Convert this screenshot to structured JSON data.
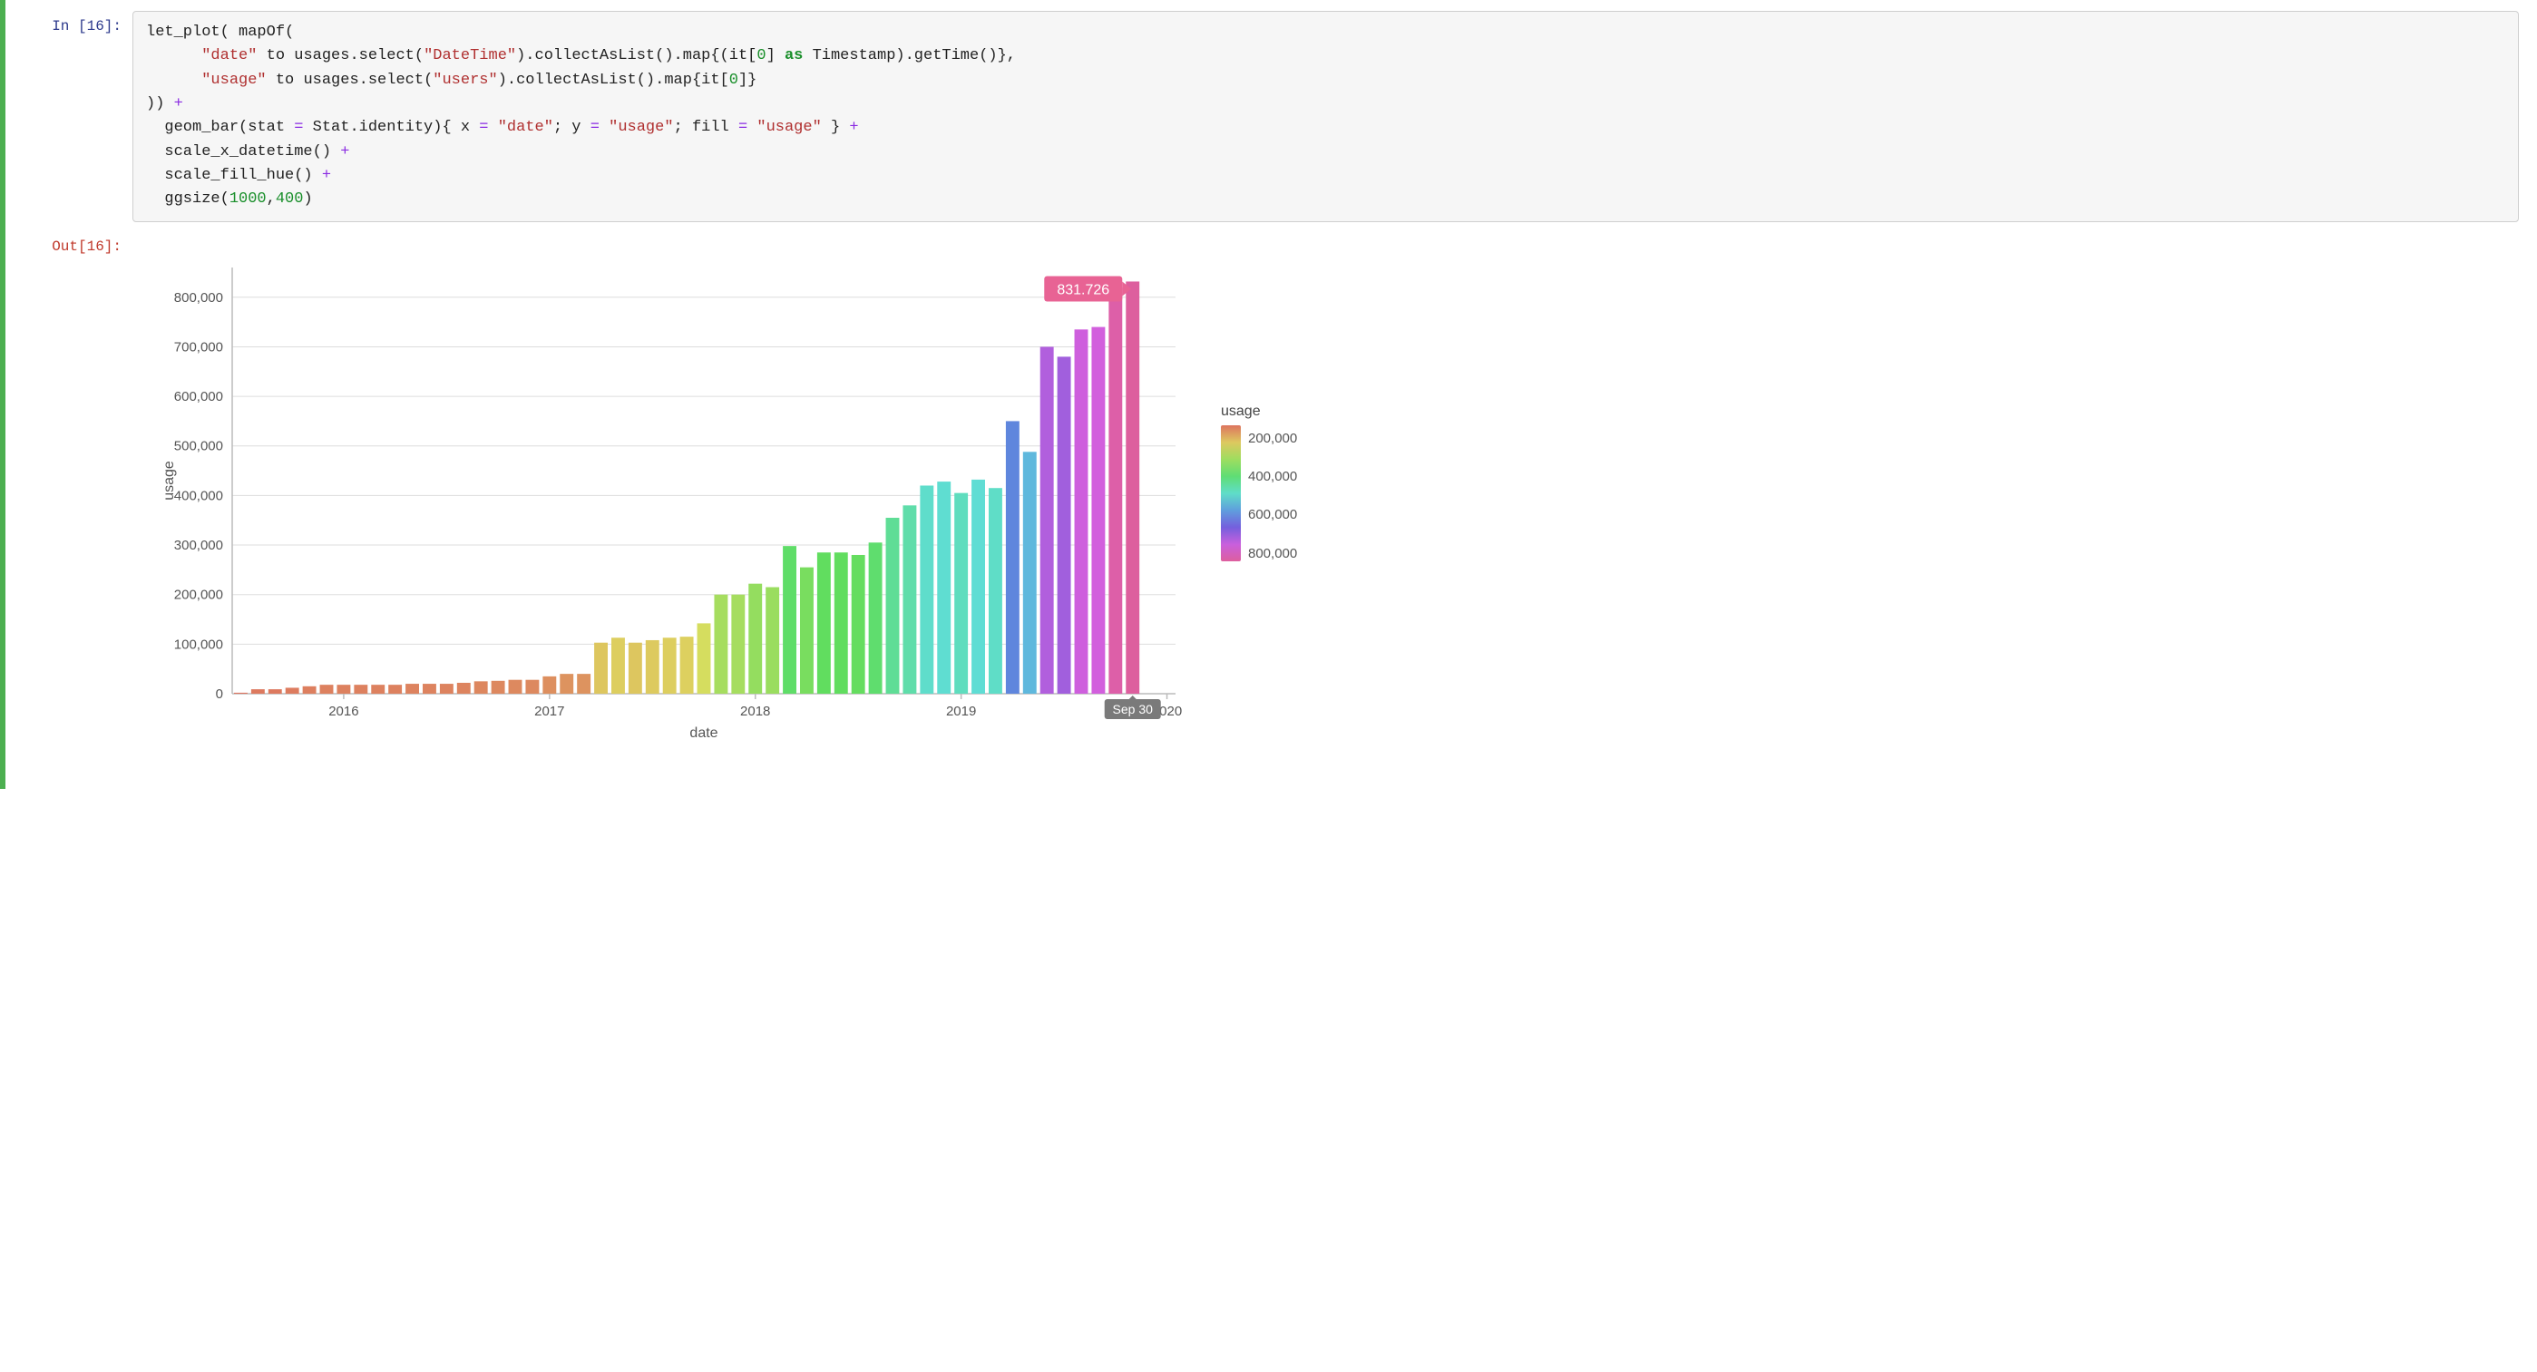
{
  "cell": {
    "in_prompt": "In [16]:",
    "out_prompt": "Out[16]:",
    "code_lines": [
      {
        "segments": [
          {
            "t": "let_plot( mapOf("
          }
        ]
      },
      {
        "segments": [
          {
            "t": "      "
          },
          {
            "t": "\"date\"",
            "c": "tok-str"
          },
          {
            "t": " to usages.select("
          },
          {
            "t": "\"DateTime\"",
            "c": "tok-str"
          },
          {
            "t": ").collectAsList().map{(it["
          },
          {
            "t": "0",
            "c": "tok-num"
          },
          {
            "t": "] "
          },
          {
            "t": "as",
            "c": "tok-kw"
          },
          {
            "t": " Timestamp).getTime()},"
          }
        ]
      },
      {
        "segments": [
          {
            "t": "      "
          },
          {
            "t": "\"usage\"",
            "c": "tok-str"
          },
          {
            "t": " to usages.select("
          },
          {
            "t": "\"users\"",
            "c": "tok-str"
          },
          {
            "t": ").collectAsList().map{it["
          },
          {
            "t": "0",
            "c": "tok-num"
          },
          {
            "t": "]}"
          }
        ]
      },
      {
        "segments": [
          {
            "t": ")) "
          },
          {
            "t": "+",
            "c": "tok-op"
          }
        ]
      },
      {
        "segments": [
          {
            "t": "  geom_bar(stat "
          },
          {
            "t": "=",
            "c": "tok-op"
          },
          {
            "t": " Stat.identity){ x "
          },
          {
            "t": "=",
            "c": "tok-op"
          },
          {
            "t": " "
          },
          {
            "t": "\"date\"",
            "c": "tok-str"
          },
          {
            "t": "; y "
          },
          {
            "t": "=",
            "c": "tok-op"
          },
          {
            "t": " "
          },
          {
            "t": "\"usage\"",
            "c": "tok-str"
          },
          {
            "t": "; fill "
          },
          {
            "t": "=",
            "c": "tok-op"
          },
          {
            "t": " "
          },
          {
            "t": "\"usage\"",
            "c": "tok-str"
          },
          {
            "t": " } "
          },
          {
            "t": "+",
            "c": "tok-op"
          }
        ]
      },
      {
        "segments": [
          {
            "t": "  scale_x_datetime() "
          },
          {
            "t": "+",
            "c": "tok-op"
          }
        ]
      },
      {
        "segments": [
          {
            "t": "  scale_fill_hue() "
          },
          {
            "t": "+",
            "c": "tok-op"
          }
        ]
      },
      {
        "segments": [
          {
            "t": "  ggsize("
          },
          {
            "t": "1000",
            "c": "tok-num"
          },
          {
            "t": ","
          },
          {
            "t": "400",
            "c": "tok-num"
          },
          {
            "t": ")"
          }
        ]
      }
    ]
  },
  "chart_data": {
    "type": "bar",
    "xlabel": "date",
    "ylabel": "usage",
    "ylim": [
      0,
      860000
    ],
    "y_ticks": [
      0,
      100000,
      200000,
      300000,
      400000,
      500000,
      600000,
      700000,
      800000
    ],
    "y_tick_labels": [
      "0",
      "100,000",
      "200,000",
      "300,000",
      "400,000",
      "500,000",
      "600,000",
      "700,000",
      "800,000"
    ],
    "x_years": [
      "2016",
      "2017",
      "2018",
      "2019",
      "2020"
    ],
    "categories": [
      "2015-07",
      "2015-08",
      "2015-09",
      "2015-10",
      "2015-11",
      "2015-12",
      "2016-01",
      "2016-02",
      "2016-03",
      "2016-04",
      "2016-05",
      "2016-06",
      "2016-07",
      "2016-08",
      "2016-09",
      "2016-10",
      "2016-11",
      "2016-12",
      "2017-01",
      "2017-02",
      "2017-03",
      "2017-04",
      "2017-05",
      "2017-06",
      "2017-07",
      "2017-08",
      "2017-09",
      "2017-10",
      "2017-11",
      "2017-12",
      "2018-01",
      "2018-02",
      "2018-03",
      "2018-04",
      "2018-05",
      "2018-06",
      "2018-07",
      "2018-08",
      "2018-09",
      "2018-10",
      "2018-11",
      "2018-12",
      "2019-01",
      "2019-02",
      "2019-03",
      "2019-04",
      "2019-05",
      "2019-06",
      "2019-07",
      "2019-08",
      "2019-09",
      "2019-10",
      "2019-11"
    ],
    "values": [
      2000,
      9000,
      9000,
      12000,
      15000,
      18000,
      18000,
      18000,
      18000,
      18000,
      20000,
      20000,
      20000,
      22000,
      25000,
      26000,
      28000,
      28000,
      35000,
      40000,
      40000,
      103000,
      113000,
      103000,
      108000,
      113000,
      115000,
      142000,
      200000,
      200000,
      222000,
      215000,
      298000,
      255000,
      285000,
      285000,
      280000,
      305000,
      355000,
      380000,
      420000,
      428000,
      405000,
      432000,
      415000,
      550000,
      488000,
      700000,
      680000,
      735000,
      740000,
      820000,
      831726
    ],
    "tooltip": {
      "value": "831.726",
      "x_label": "Sep 30",
      "index": 52
    },
    "year_start_index": {
      "2016": 6,
      "2017": 18,
      "2018": 30,
      "2019": 42,
      "2020": 54
    },
    "legend": {
      "title": "usage",
      "ticks": [
        "200,000",
        "400,000",
        "600,000",
        "800,000"
      ]
    }
  }
}
